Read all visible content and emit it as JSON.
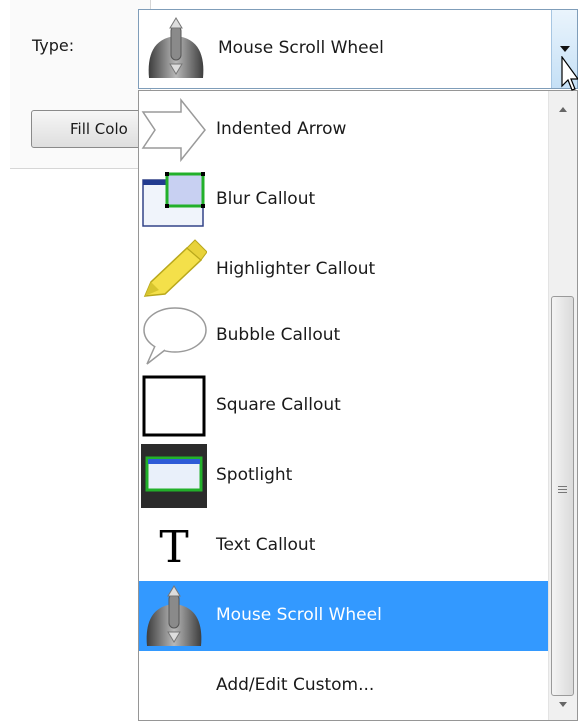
{
  "type_label": "Type:",
  "fill_button_label": "Fill Colo",
  "combo": {
    "selected": "Mouse Scroll Wheel",
    "icon": "mouse-icon"
  },
  "items": [
    {
      "label": "Indented Arrow",
      "icon": "indented-arrow-icon"
    },
    {
      "label": "Blur Callout",
      "icon": "blur-callout-icon"
    },
    {
      "label": "Highlighter Callout",
      "icon": "highlighter-icon"
    },
    {
      "label": "Bubble Callout",
      "icon": "bubble-callout-icon"
    },
    {
      "label": "Square Callout",
      "icon": "square-callout-icon"
    },
    {
      "label": "Spotlight",
      "icon": "spotlight-icon"
    },
    {
      "label": "Text Callout",
      "icon": "text-callout-icon"
    },
    {
      "label": "Mouse Scroll Wheel",
      "icon": "mouse-icon"
    },
    {
      "label": "Add/Edit Custom...",
      "icon": ""
    }
  ],
  "selected_index": 7,
  "colors": {
    "selection": "#3399ff",
    "combo_border": "#7f9db9"
  }
}
